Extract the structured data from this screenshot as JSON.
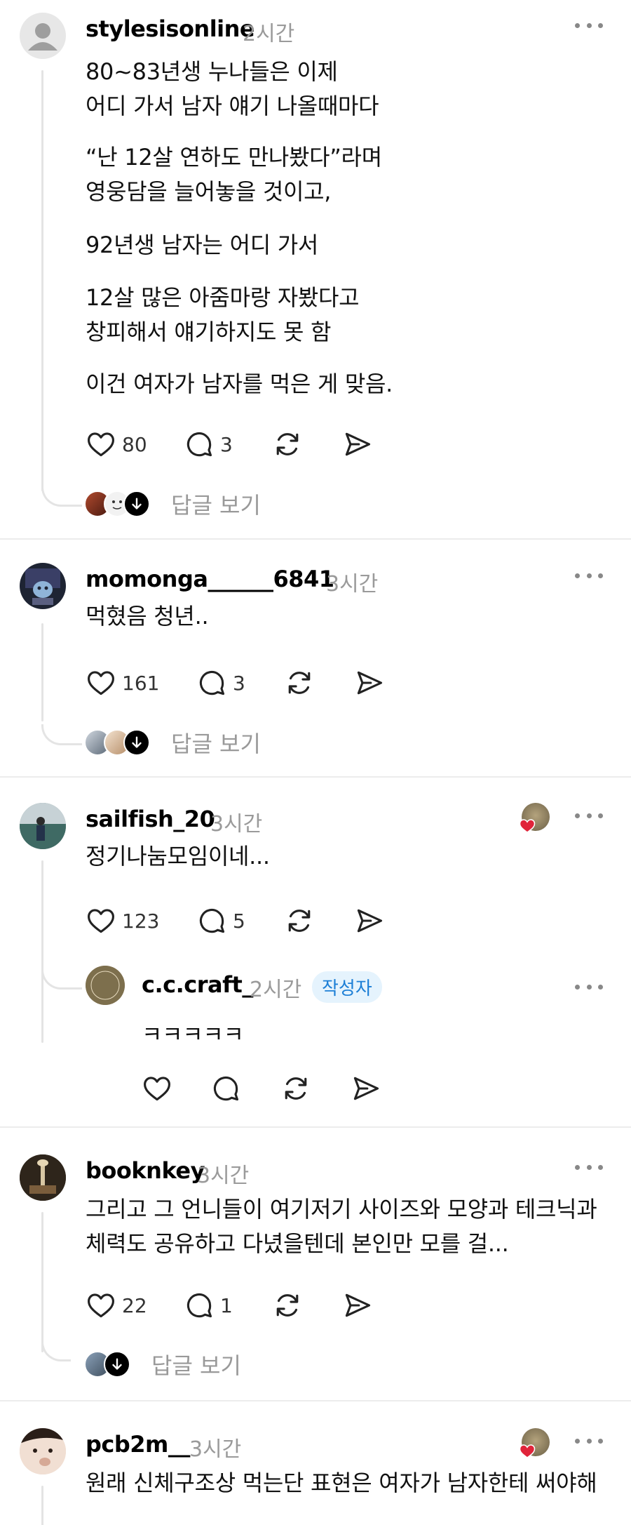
{
  "icons": {
    "like": "heart-outline-icon",
    "comment": "speech-bubble-icon",
    "repost": "repost-icon",
    "share": "send-icon",
    "more": "more-dots-icon"
  },
  "colors": {
    "accent_blue": "#1d7fd6",
    "heart_red": "#e0243a",
    "muted_gray": "#9a9a9a"
  },
  "posts": [
    {
      "username": "stylesisonline",
      "time": "2시간",
      "paragraphs": [
        [
          "80~83년생 누나들은 이제",
          "어디 가서 남자 얘기 나올때마다"
        ],
        [
          "“난 12살 연하도 만나봤다”라며",
          "영웅담을 늘어놓을 것이고,"
        ],
        [
          "92년생 남자는 어디 가서"
        ],
        [
          "12살 많은 아줌마랑 자봤다고",
          "창피해서 얘기하지도 못 함"
        ],
        [
          "이건 여자가 남자를 먹은 게 맞음."
        ]
      ],
      "likes": "80",
      "comments": "3",
      "replies_label": "답글 보기"
    },
    {
      "username": "momonga______6841",
      "time": "3시간",
      "paragraphs": [
        [
          "먹혔음 청년.."
        ]
      ],
      "likes": "161",
      "comments": "3",
      "replies_label": "답글 보기"
    },
    {
      "username": "sailfish_20",
      "time": "3시간",
      "paragraphs": [
        [
          "정기나눔모임이네..."
        ]
      ],
      "likes": "123",
      "comments": "5",
      "reply": {
        "username": "c.c.craft_",
        "time": "2시간",
        "badge": "작성자",
        "text": "ㅋㅋㅋㅋㅋ"
      }
    },
    {
      "username": "booknkey",
      "time": "3시간",
      "paragraphs": [
        [
          "그리고 그 언니들이 여기저기 사이즈와 모양과 테크닉과",
          "체력도 공유하고 다녔을텐데 본인만 모를 걸..."
        ]
      ],
      "likes": "22",
      "comments": "1",
      "replies_label": "답글 보기"
    },
    {
      "username": "pcb2m__",
      "time": "3시간",
      "paragraphs": [
        [
          "원래 신체구조상 먹는단 표현은 여자가 남자한테 써야해"
        ]
      ]
    }
  ]
}
